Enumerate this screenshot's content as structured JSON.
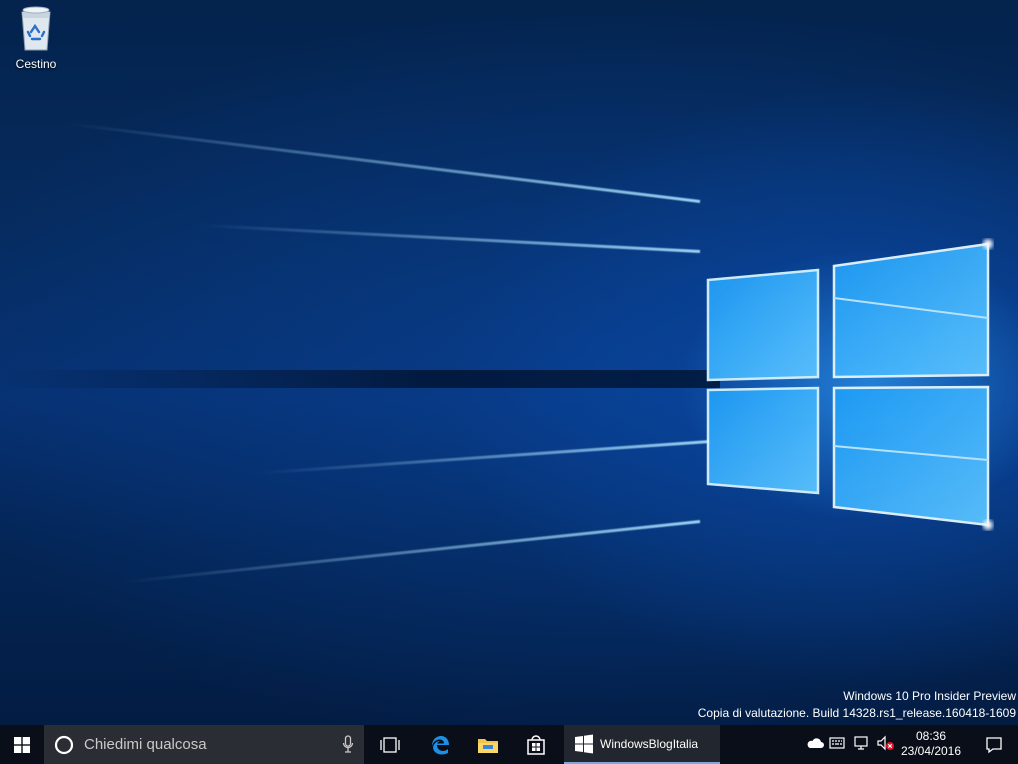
{
  "desktop": {
    "icons": [
      {
        "label": "Cestino",
        "icon": "recycle-bin-icon"
      }
    ]
  },
  "watermark": {
    "line1": "Windows 10 Pro Insider Preview",
    "line2": "Copia di valutazione. Build 14328.rs1_release.160418-1609"
  },
  "taskbar": {
    "search_placeholder": "Chiedimi qualcosa",
    "pinned": [
      "task-view-icon",
      "edge-icon",
      "file-explorer-icon",
      "store-icon"
    ],
    "open_app": {
      "label": "WindowsBlogItalia",
      "icon": "windowsblogitalia-icon"
    },
    "tray": [
      "onedrive-icon",
      "input-icon",
      "network-icon",
      "volume-muted-icon"
    ],
    "clock": {
      "time": "08:36",
      "date": "23/04/2016"
    },
    "colors": {
      "background": "#0a0e18",
      "search": "#2a2d33",
      "accent": "#7fa7d9"
    }
  }
}
